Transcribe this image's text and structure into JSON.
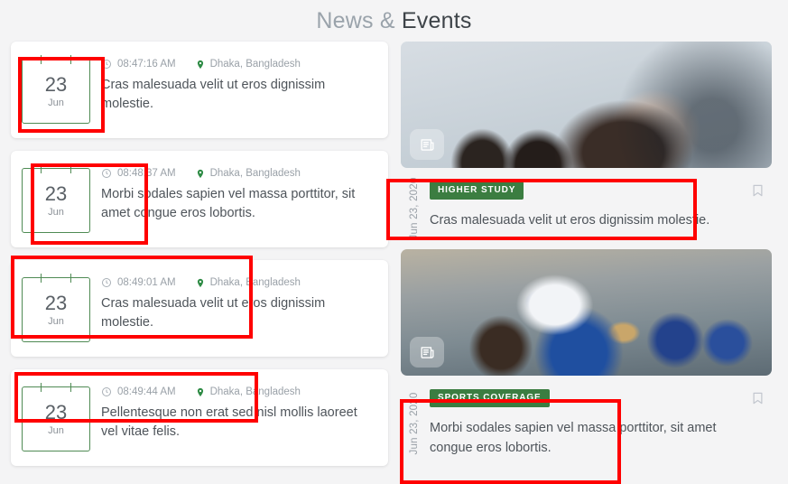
{
  "header": {
    "title_light": "News &",
    "title_dark": "Events"
  },
  "events": {
    "items": [
      {
        "day": "23",
        "month": "Jun",
        "time": "08:47:16 AM",
        "location": "Dhaka, Bangladesh",
        "text": "Cras malesuada velit ut eros dignissim molestie."
      },
      {
        "day": "23",
        "month": "Jun",
        "time": "08:48:37 AM",
        "location": "Dhaka, Bangladesh",
        "text": "Morbi sodales sapien vel massa porttitor, sit amet congue eros lobortis."
      },
      {
        "day": "23",
        "month": "Jun",
        "time": "08:49:01 AM",
        "location": "Dhaka, Bangladesh",
        "text": "Cras malesuada velit ut eros dignissim molestie."
      },
      {
        "day": "23",
        "month": "Jun",
        "time": "08:49:44 AM",
        "location": "Dhaka, Bangladesh",
        "text": "Pellentesque non erat sed nisl mollis laoreet vel vitae felis."
      }
    ],
    "icons": {
      "clock": "clock-icon",
      "location": "location-pin-icon",
      "calendar": "calendar-icon"
    }
  },
  "news": {
    "items": [
      {
        "date": "Jun 23, 2020",
        "category": "HIGHER STUDY",
        "headline": "Cras malesuada velit ut eros dignissim molestie.",
        "thumb_icon": "newspaper-icon",
        "bookmark_icon": "bookmark-icon"
      },
      {
        "date": "Jun 23, 2020",
        "category": "SPORTS COVERAGE",
        "headline": "Morbi sodales sapien vel massa porttitor, sit amet congue eros lobortis.",
        "thumb_icon": "newspaper-icon",
        "bookmark_icon": "bookmark-icon"
      }
    ]
  },
  "colors": {
    "badge_green": "#3b7d41",
    "pin_green": "#2e8b45",
    "calendar_green": "#4f8b54",
    "annotation_red": "#ff0000",
    "page_bg": "#f4f4f5",
    "text_primary": "#4e545a",
    "text_muted": "#9aa1a8"
  }
}
